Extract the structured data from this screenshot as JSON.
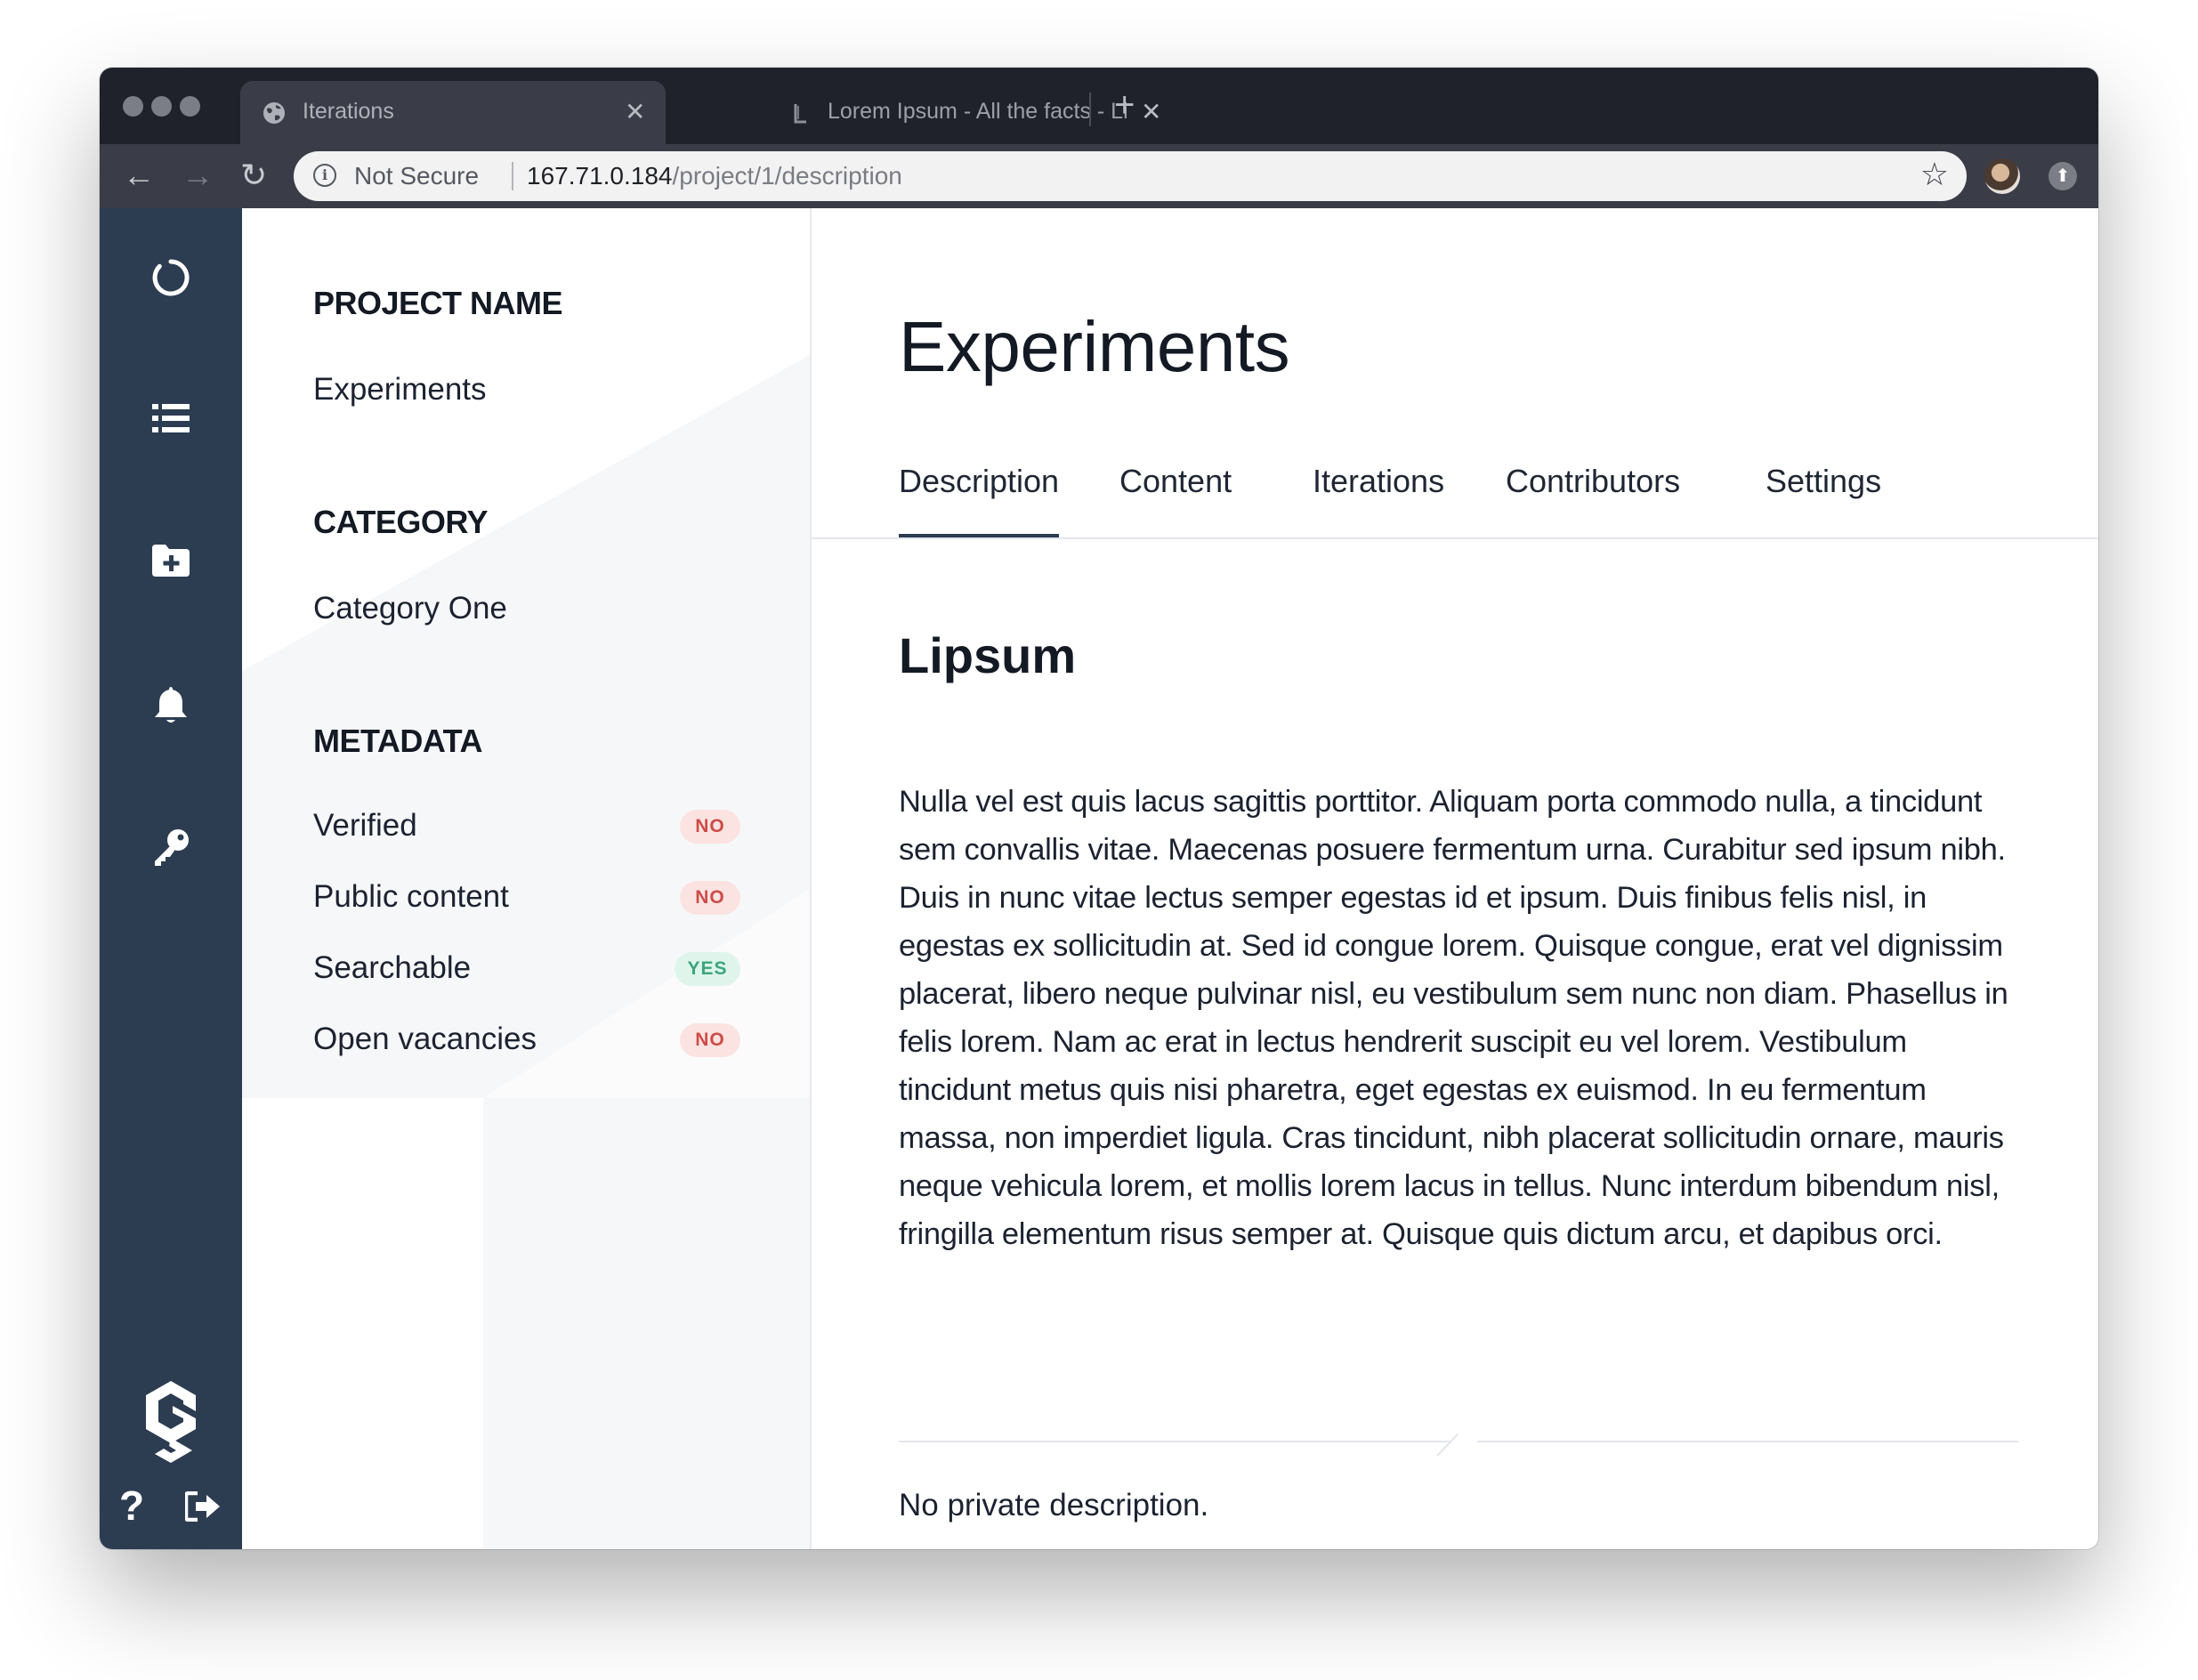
{
  "browser": {
    "tabs": [
      {
        "title": "Iterations",
        "active": true
      },
      {
        "title": "Lorem Ipsum - All the facts - Li",
        "active": false
      }
    ],
    "security_label": "Not Secure",
    "url_host": "167.71.0.184",
    "url_path": "/project/1/description"
  },
  "sidebar_rail": {
    "icons": [
      "loading-icon",
      "list-icon",
      "folder-plus-icon",
      "bell-icon",
      "key-icon",
      "logo-icon",
      "help-icon",
      "logout-icon"
    ]
  },
  "project_panel": {
    "project_name_heading": "PROJECT NAME",
    "project_name": "Experiments",
    "category_heading": "CATEGORY",
    "category": "Category One",
    "metadata_heading": "METADATA",
    "metadata": [
      {
        "label": "Verified",
        "value": "NO"
      },
      {
        "label": "Public content",
        "value": "NO"
      },
      {
        "label": "Searchable",
        "value": "YES"
      },
      {
        "label": "Open vacancies",
        "value": "NO"
      }
    ]
  },
  "main": {
    "title": "Experiments",
    "tabs": [
      "Description",
      "Content",
      "Iterations",
      "Contributors",
      "Settings"
    ],
    "active_tab": "Description",
    "heading": "Lipsum",
    "body": "Nulla vel est quis lacus sagittis porttitor. Aliquam porta commodo nulla, a tincidunt sem convallis vitae. Maecenas posuere fermentum urna. Curabitur sed ipsum nibh. Duis in nunc vitae lectus semper egestas id et ipsum. Duis finibus felis nisl, in egestas ex sollicitudin at. Sed id congue lorem. Quisque congue, erat vel dignissim placerat, libero neque pulvinar nisl, eu vestibulum sem nunc non diam. Phasellus in felis lorem. Nam ac erat in lectus hendrerit suscipit eu vel lorem. Vestibulum tincidunt metus quis nisi pharetra, eget egestas ex euismod. In eu fermentum massa, non imperdiet ligula. Cras tincidunt, nibh placerat sollicitudin ornare, mauris neque vehicula lorem, et mollis lorem lacus in tellus. Nunc interdum bibendum nisl, fringilla elementum risus semper at. Quisque quis dictum arcu, et dapibus orci.",
    "private_description": "No private description."
  },
  "colors": {
    "rail": "#2c3d52",
    "badge_no_bg": "#fbe3e1",
    "badge_no_text": "#cc4c48",
    "badge_yes_bg": "#dff5ec",
    "badge_yes_text": "#3aa57c"
  }
}
